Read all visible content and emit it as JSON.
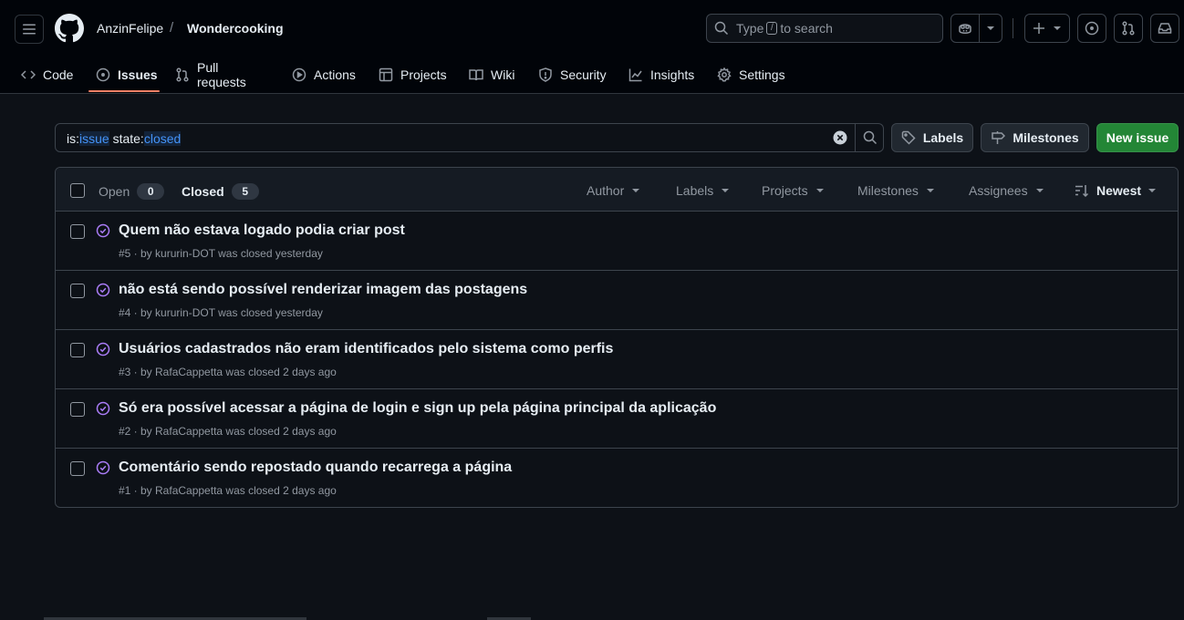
{
  "header": {
    "owner": "AnzinFelipe",
    "separator": "/",
    "repo": "Wondercooking",
    "search_prefix": "Type",
    "search_key": "/",
    "search_suffix": "to search"
  },
  "tabs": [
    {
      "label": "Code",
      "icon": "code-icon"
    },
    {
      "label": "Issues",
      "icon": "issue-opened-icon",
      "active": true
    },
    {
      "label": "Pull requests",
      "icon": "git-pull-request-icon"
    },
    {
      "label": "Actions",
      "icon": "play-icon"
    },
    {
      "label": "Projects",
      "icon": "table-icon"
    },
    {
      "label": "Wiki",
      "icon": "book-icon"
    },
    {
      "label": "Security",
      "icon": "shield-icon"
    },
    {
      "label": "Insights",
      "icon": "graph-icon"
    },
    {
      "label": "Settings",
      "icon": "gear-icon"
    }
  ],
  "filter": {
    "t1": "is:",
    "t2": "issue",
    "t3": " state:",
    "t4": "closed"
  },
  "buttons": {
    "labels": "Labels",
    "milestones": "Milestones",
    "new_issue": "New issue"
  },
  "list_header": {
    "open_label": "Open",
    "open_count": "0",
    "closed_label": "Closed",
    "closed_count": "5",
    "filters": [
      "Author",
      "Labels",
      "Projects",
      "Milestones",
      "Assignees",
      "Newest"
    ]
  },
  "issues": [
    {
      "title": "Quem não estava logado podia criar post",
      "meta": "#5 · by kururin-DOT was closed yesterday"
    },
    {
      "title": "não está sendo possível renderizar imagem das postagens",
      "meta": "#4 · by kururin-DOT was closed yesterday"
    },
    {
      "title": "Usuários cadastrados não eram identificados pelo sistema como perfis",
      "meta": "#3 · by RafaCappetta was closed 2 days ago"
    },
    {
      "title": "Só era possível acessar a página de login e sign up pela página principal da aplicação",
      "meta": "#2 · by RafaCappetta was closed 2 days ago"
    },
    {
      "title": "Comentário sendo repostado quando recarrega a página",
      "meta": "#1 · by RafaCappetta was closed 2 days ago"
    }
  ],
  "colors": {
    "background": "#0d1117",
    "header_bg": "#010409",
    "closed_purple": "#ab7df8",
    "link_blue": "#4493f8",
    "accent_underline": "#f78166",
    "green_button": "#238636"
  }
}
